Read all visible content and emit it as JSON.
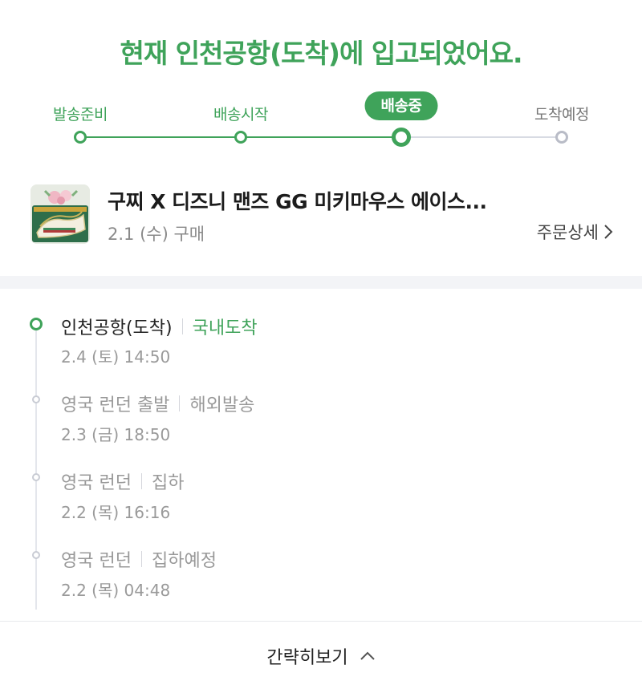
{
  "headline": "현재 인천공항(도착)에 입고되었어요.",
  "steps": [
    {
      "label": "발송준비",
      "state": "done"
    },
    {
      "label": "배송시작",
      "state": "done"
    },
    {
      "label": "배송중",
      "state": "current"
    },
    {
      "label": "도착예정",
      "state": "future"
    }
  ],
  "product": {
    "name": "구찌 X 디즈니 맨즈 GG 미키마우스 에이스...",
    "purchase_date": "2.1 (수) 구매",
    "order_detail_label": "주문상세"
  },
  "timeline": [
    {
      "location": "인천공항(도착)",
      "status": "국내도착",
      "time": "2.4 (토) 14:50",
      "current": true
    },
    {
      "location": "영국 런던 출발",
      "status": "해외발송",
      "time": "2.3 (금) 18:50",
      "current": false
    },
    {
      "location": "영국 런던",
      "status": "집하",
      "time": "2.2 (목) 16:16",
      "current": false
    },
    {
      "location": "영국 런던",
      "status": "집하예정",
      "time": "2.2 (목) 04:48",
      "current": false
    }
  ],
  "collapse_label": "간략히보기",
  "colors": {
    "accent": "#3fa35a",
    "inactive": "#b9bcc7"
  },
  "icons": {
    "order_detail": "chevron-right-icon",
    "collapse": "chevron-up-icon",
    "timeline_node": "circle-icon"
  }
}
